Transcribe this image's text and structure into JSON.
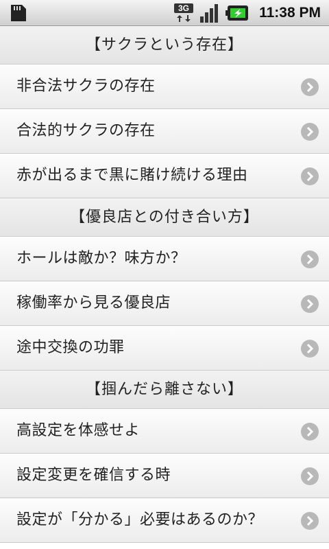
{
  "status_bar": {
    "network_type": "3G",
    "time": "11:38 PM",
    "icons": [
      "sd-card-icon",
      "network-3g-icon",
      "signal-strength-icon",
      "battery-charging-icon"
    ]
  },
  "sections": [
    {
      "header": "【サクラという存在】",
      "items": [
        {
          "label": "非合法サクラの存在"
        },
        {
          "label": "合法的サクラの存在"
        },
        {
          "label": "赤が出るまで黒に賭け続ける理由"
        }
      ]
    },
    {
      "header": "【優良店との付き合い方】",
      "items": [
        {
          "label": "ホールは敵か？味方か？"
        },
        {
          "label": "稼働率から見る優良店"
        },
        {
          "label": "途中交換の功罪"
        }
      ]
    },
    {
      "header": "【掴んだら離さない】",
      "items": [
        {
          "label": "高設定を体感せよ"
        },
        {
          "label": "設定変更を確信する時"
        },
        {
          "label": "設定が「分かる」必要はあるのか？"
        }
      ]
    }
  ],
  "colors": {
    "text": "#222222",
    "arrow": "#b8b8b8",
    "battery_accent": "#33cc33"
  }
}
